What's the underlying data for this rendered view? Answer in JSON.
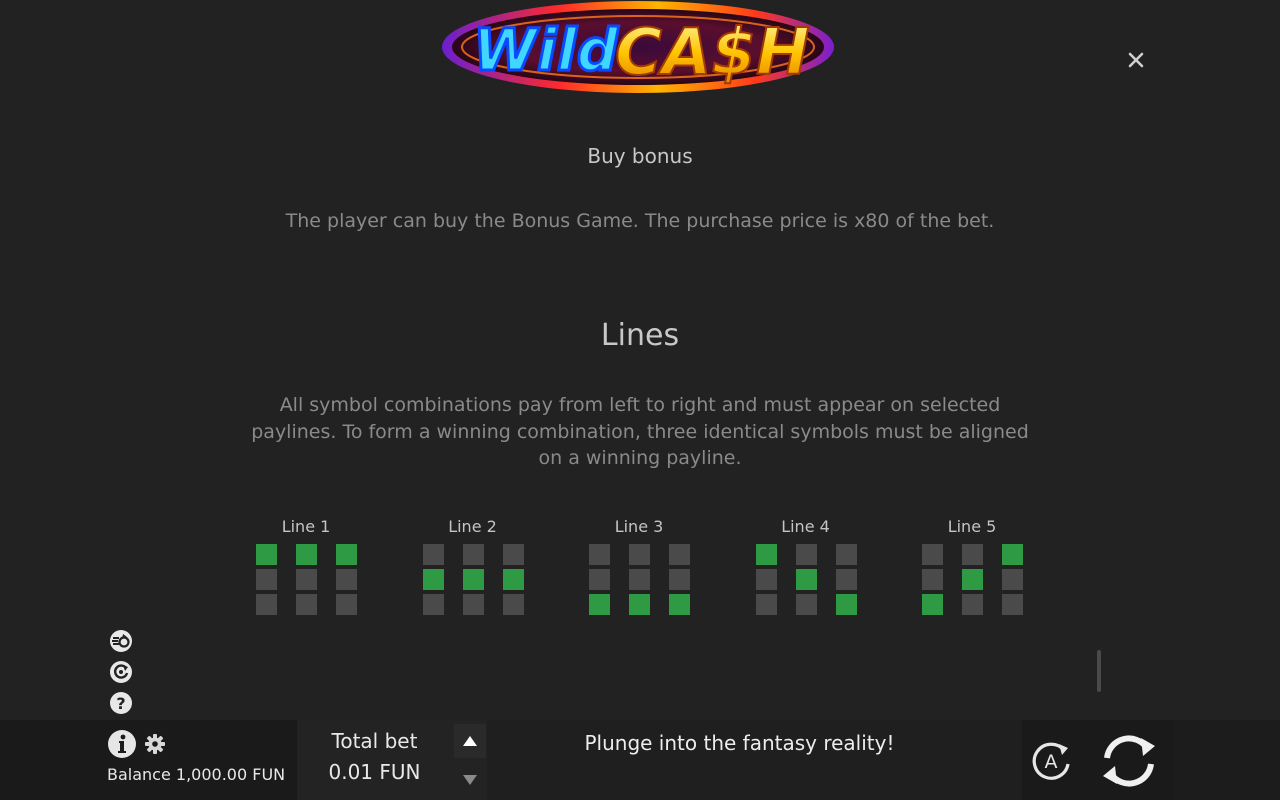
{
  "logo": {
    "word1": "Wild",
    "word2": "CA$H"
  },
  "close": {
    "glyph": "×"
  },
  "buy_bonus": {
    "title": "Buy bonus",
    "text": "The player can buy the Bonus Game. The purchase price is x80 of the bet."
  },
  "lines": {
    "title": "Lines",
    "text": "All symbol combinations pay from left to right and must appear on selected paylines. To form a winning combination, three identical symbols must be aligned on a winning payline.",
    "items": [
      {
        "label": "Line 1",
        "rows": [
          0,
          0,
          0
        ]
      },
      {
        "label": "Line 2",
        "rows": [
          1,
          1,
          1
        ]
      },
      {
        "label": "Line 3",
        "rows": [
          2,
          2,
          2
        ]
      },
      {
        "label": "Line 4",
        "rows": [
          0,
          1,
          2
        ]
      },
      {
        "label": "Line 5",
        "rows": [
          2,
          1,
          0
        ]
      }
    ]
  },
  "colors": {
    "background": "#222222",
    "cell_off": "#4a4a4a",
    "cell_on": "#2f9a44",
    "bar": "#1c1c1c"
  },
  "side_icons": [
    "turbo-icon",
    "replay-icon",
    "help-icon"
  ],
  "bottom_bar": {
    "balance": "Balance 1,000.00 FUN",
    "total_bet_label": "Total bet",
    "total_bet_value": "0.01 FUN",
    "message": "Plunge into the fantasy reality!",
    "auto_label": "A"
  }
}
